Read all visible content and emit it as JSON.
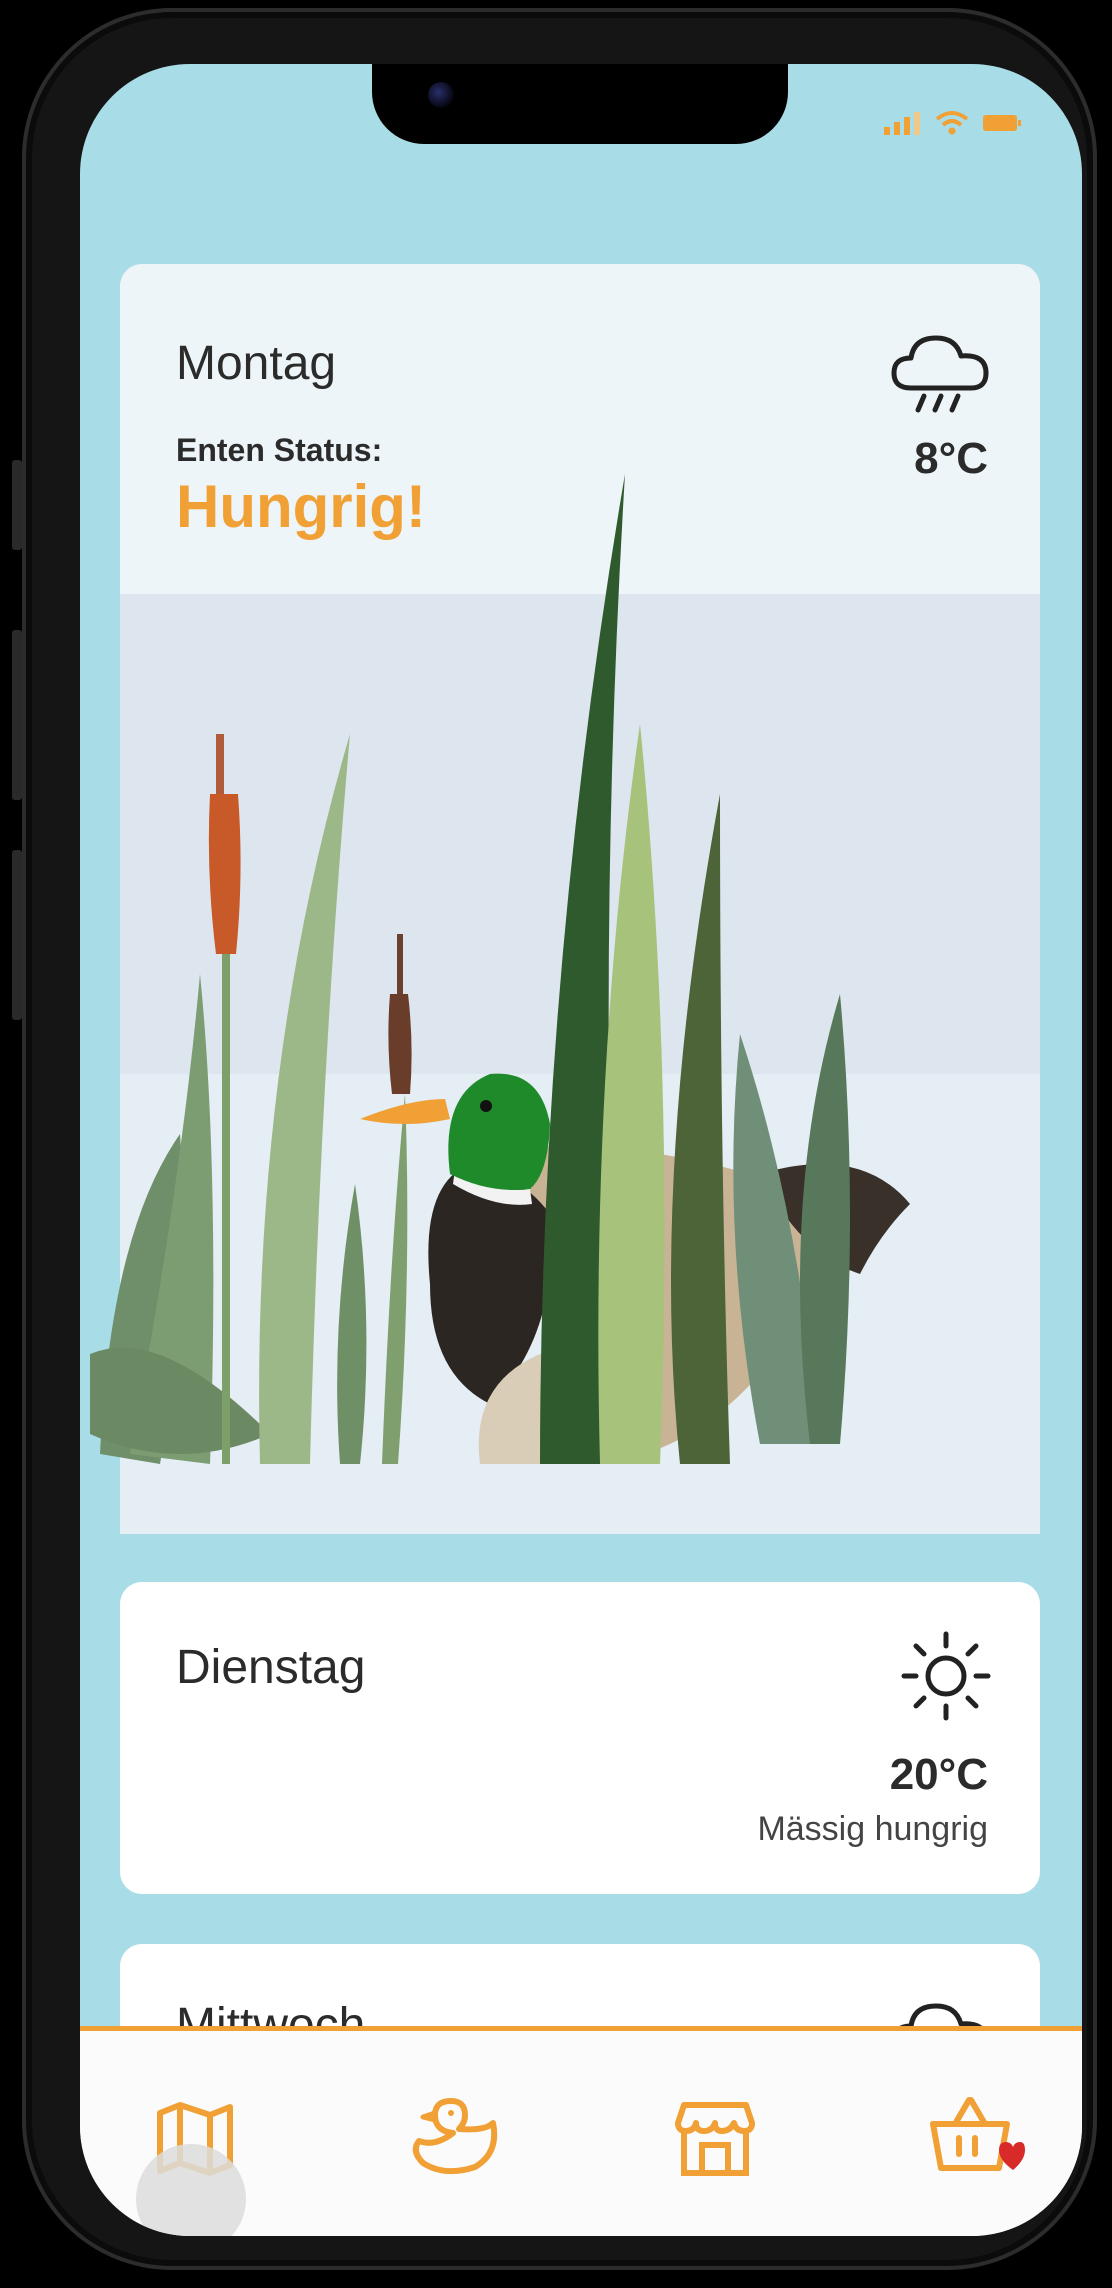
{
  "today": {
    "day": "Montag",
    "status_label": "Enten Status:",
    "status_value": "Hungrig!",
    "temperature": "8°C",
    "weather_icon": "rain-cloud-icon"
  },
  "forecast": [
    {
      "day": "Dienstag",
      "temperature": "20°C",
      "mood": "Mässig hungrig",
      "weather_icon": "sun-icon"
    },
    {
      "day": "Mittwoch",
      "weather_icon": "cloud-icon"
    }
  ],
  "tabs": [
    {
      "icon": "map-icon"
    },
    {
      "icon": "duck-icon"
    },
    {
      "icon": "shop-icon"
    },
    {
      "icon": "basket-heart-icon"
    }
  ],
  "colors": {
    "accent": "#f0a034",
    "background": "#a8dce6",
    "card": "#ffffff"
  }
}
